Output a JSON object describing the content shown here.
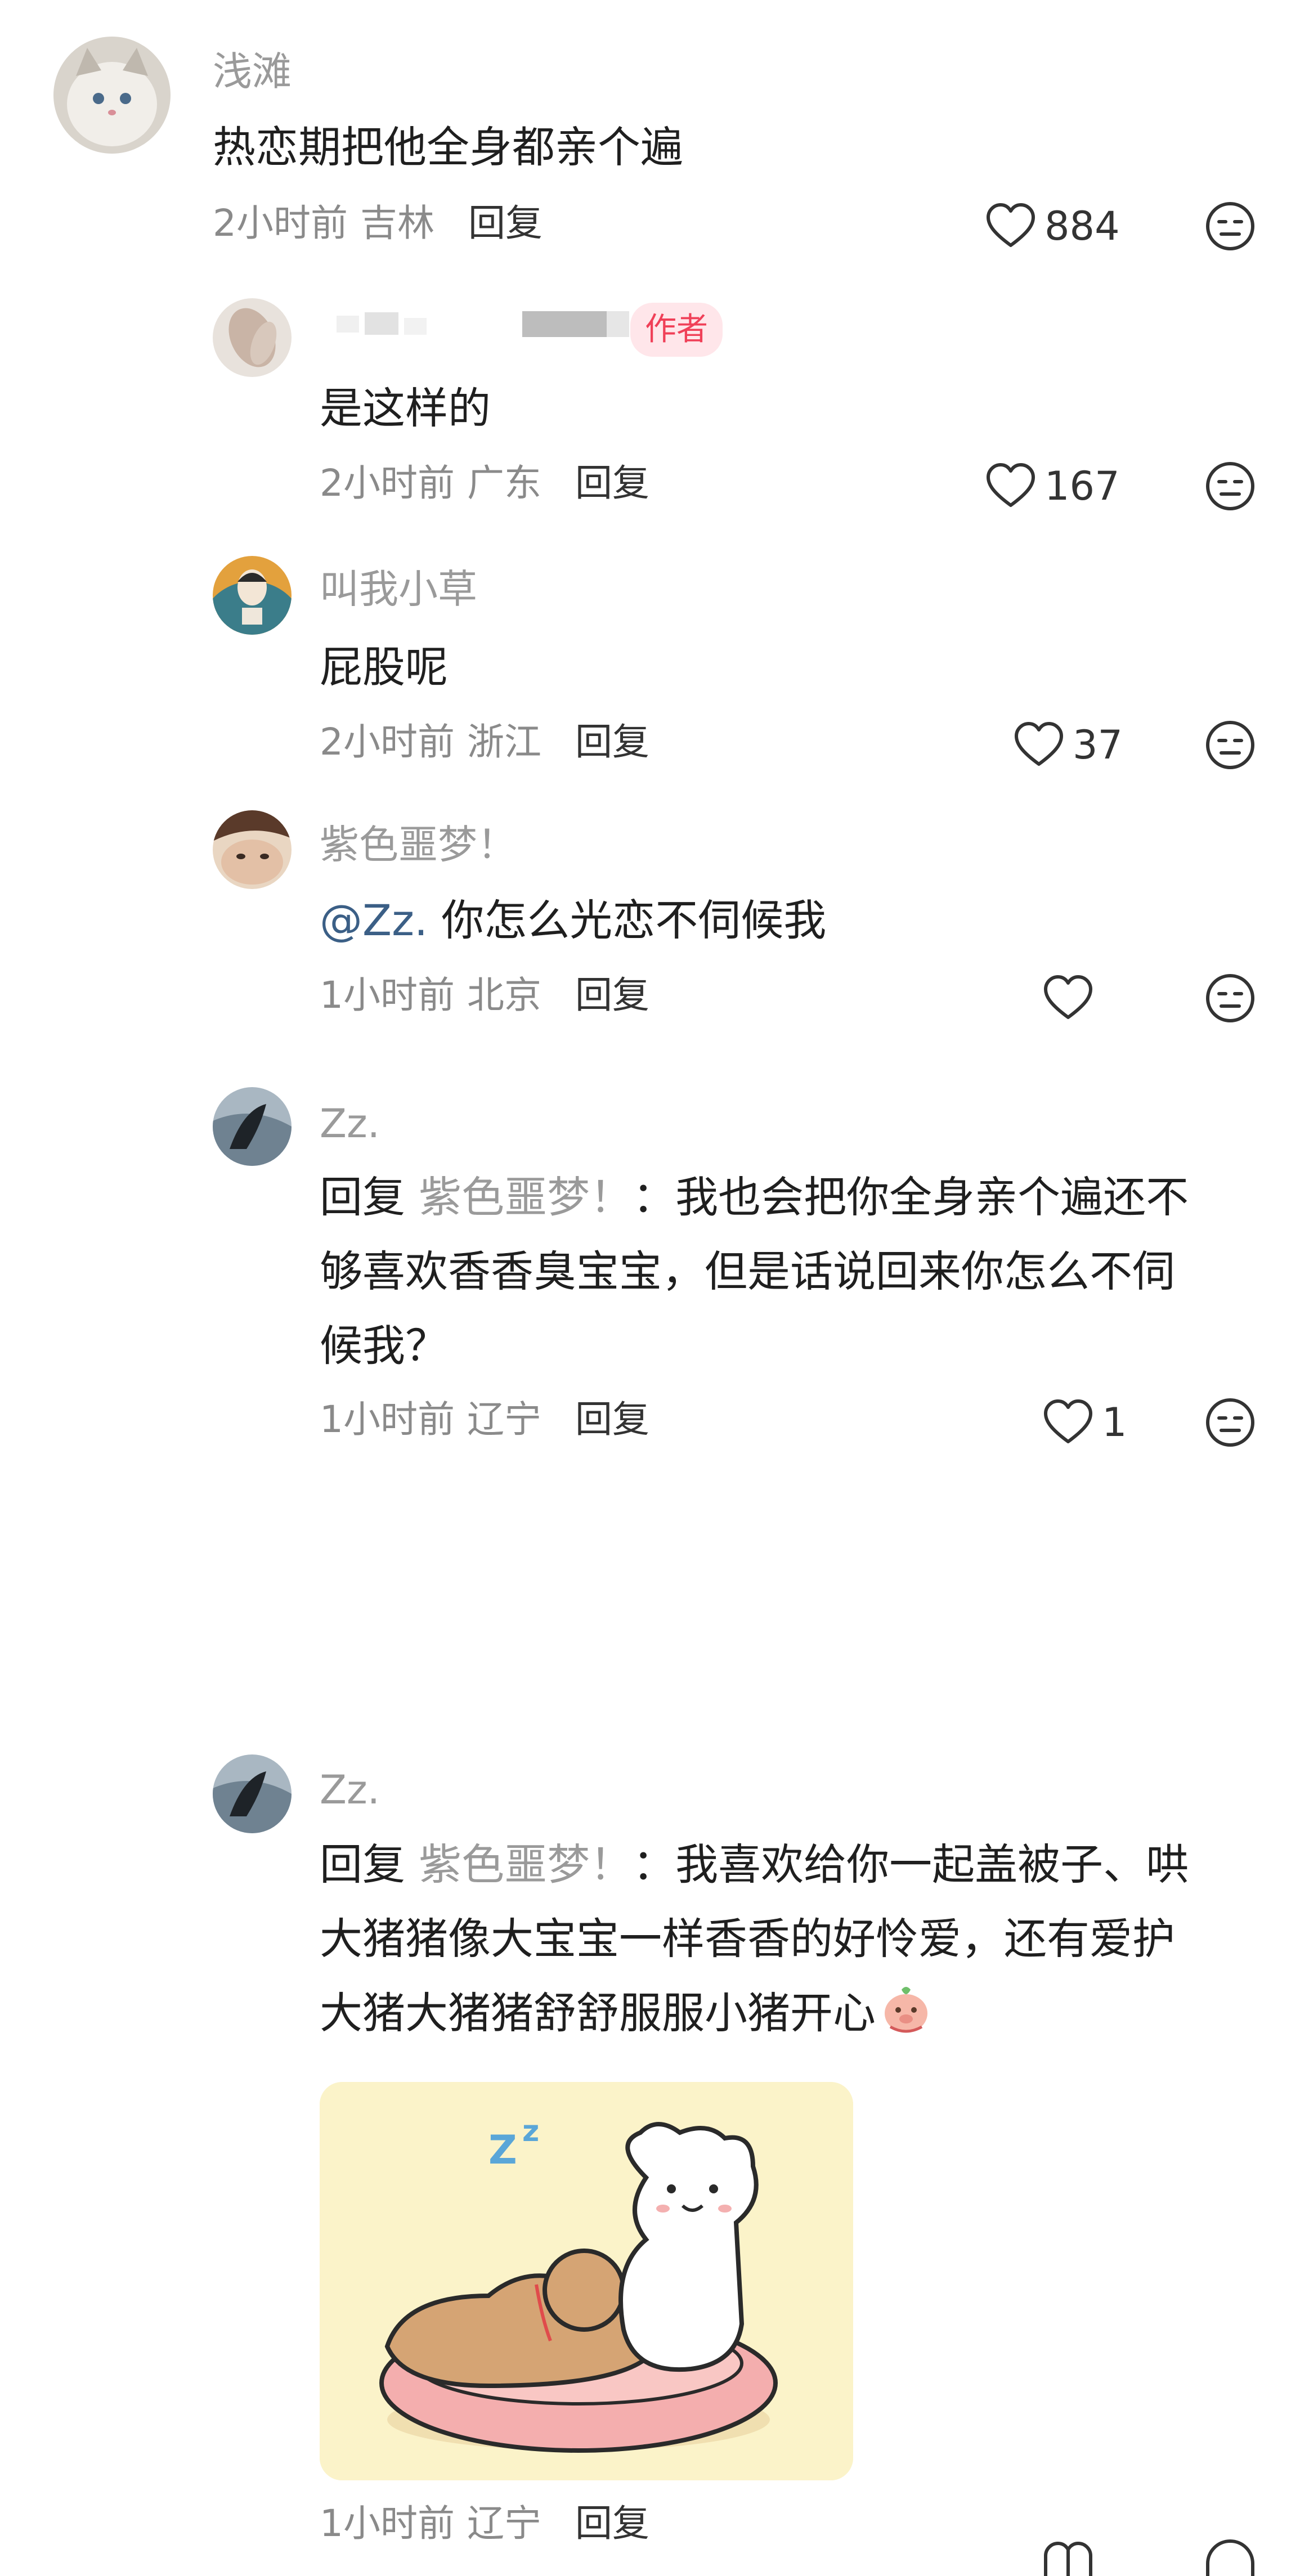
{
  "comments": [
    {
      "username": "浅滩",
      "text": "热恋期把他全身都亲个遍",
      "time": "2小时前",
      "location": "吉林",
      "reply_label": "回复",
      "likes": "884"
    },
    {
      "author_badge": "作者",
      "text": "是这样的",
      "time": "2小时前",
      "location": "广东",
      "reply_label": "回复",
      "likes": "167"
    },
    {
      "username": "叫我小草",
      "text": "屁股呢",
      "time": "2小时前",
      "location": "浙江",
      "reply_label": "回复",
      "likes": "37"
    },
    {
      "username": "紫色噩梦！",
      "mention": "@Zz.",
      "text": "你怎么光恋不伺候我",
      "time": "1小时前",
      "location": "北京",
      "reply_label": "回复",
      "likes": ""
    },
    {
      "username": "Zz.",
      "reply_prefix": "回复",
      "reply_to": "紫色噩梦！",
      "text_line1": "：我也会把你全身亲个遍还不",
      "text_line2": "够喜欢香香臭宝宝，但是话说回来你怎么不伺",
      "text_line3": "候我？",
      "time": "1小时前",
      "location": "辽宁",
      "reply_label": "回复",
      "likes": "1"
    },
    {
      "username": "Zz.",
      "reply_prefix": "回复",
      "reply_to": "紫色噩梦！",
      "text_line1": "：我喜欢给你一起盖被子、哄",
      "text_line2": "大猪猪像大宝宝一样香香的好怜爱，还有爱护",
      "text_line3": "大猪大猪猪舒舒服服小猪开心",
      "time": "1小时前",
      "location": "辽宁",
      "reply_label": "回复"
    }
  ],
  "colors": {
    "meta_gray": "#8a8a8a",
    "name_gray": "#9a9a9a",
    "mention_blue": "#3b5f86",
    "author_badge_bg": "#ffe6ea",
    "author_badge_text": "#f04058"
  },
  "icons": [
    "heart-icon",
    "dislike-face-icon",
    "piggy-emoji-icon",
    "sleeping-bears-sticker"
  ]
}
